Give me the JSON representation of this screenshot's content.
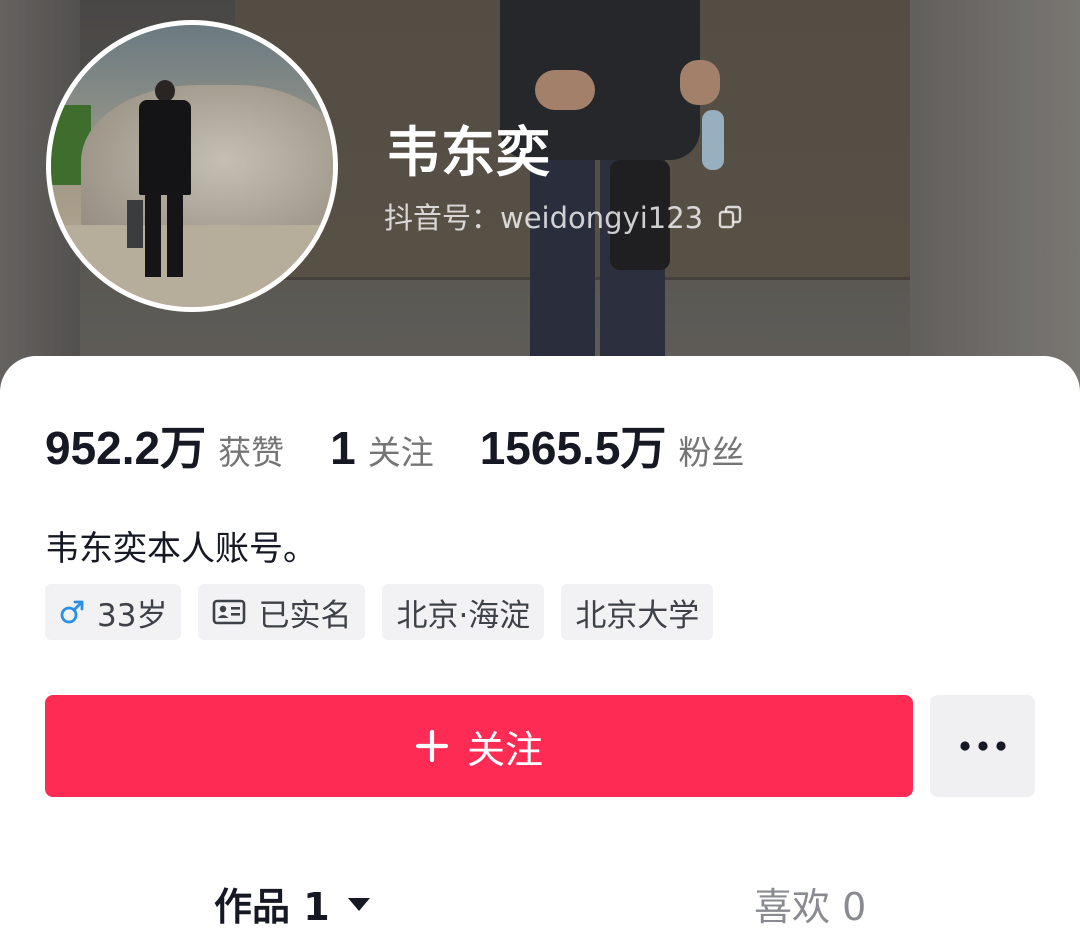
{
  "profile": {
    "name": "韦东奕",
    "douyin_id": "抖音号：weidongyi123"
  },
  "stats": [
    {
      "value": "952.2万",
      "label": "获赞"
    },
    {
      "value": "1",
      "label": "关注"
    },
    {
      "value": "1565.5万",
      "label": "粉丝"
    }
  ],
  "bio": "韦东奕本人账号。",
  "tags": [
    {
      "icon": "male-icon",
      "label": "33岁"
    },
    {
      "icon": "id-card-icon",
      "label": "已实名"
    },
    {
      "label": "北京·海淀"
    },
    {
      "label": "北京大学"
    }
  ],
  "actions": {
    "follow_label": "关注",
    "more_icon": "more-dots-icon"
  },
  "tabs": [
    {
      "label": "作品 1",
      "active": true
    },
    {
      "label": "喜欢 0",
      "active": false
    }
  ],
  "colors": {
    "accent": "#fe2c55",
    "male_icon": "#2b8fe5"
  }
}
